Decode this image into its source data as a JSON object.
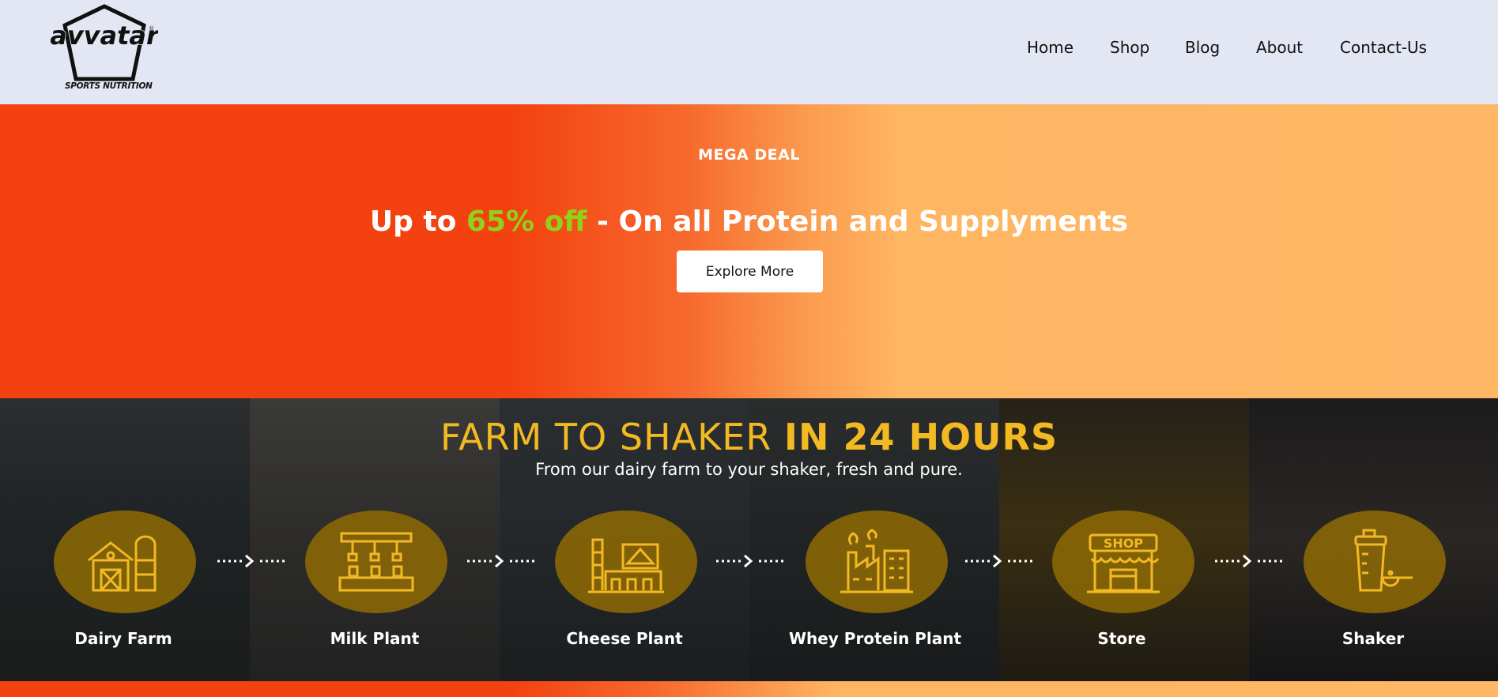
{
  "header": {
    "logo_text": "avvatar",
    "logo_tagline": "SPORTS NUTRITION",
    "nav": [
      {
        "label": "Home"
      },
      {
        "label": "Shop"
      },
      {
        "label": "Blog"
      },
      {
        "label": "About"
      },
      {
        "label": "Contact-Us"
      }
    ]
  },
  "hero": {
    "kicker": "MEGA DEAL",
    "title_prefix": "Up to ",
    "title_highlight": "65% off",
    "title_suffix": " - On all Protein and Supplyments",
    "button_label": "Explore More",
    "highlight_color": "#8ed21b",
    "gradient_start": "#f3410f",
    "gradient_end": "#ffb765"
  },
  "farm_section": {
    "title_light": "FARM TO SHAKER ",
    "title_bold": "IN 24 HOURS",
    "subtitle": "From our dairy farm to your shaker, fresh and pure.",
    "accent_color": "#f3b922",
    "steps": [
      {
        "label": "Dairy Farm",
        "icon": "barn-icon"
      },
      {
        "label": "Milk Plant",
        "icon": "milk-bottling-icon"
      },
      {
        "label": "Cheese Plant",
        "icon": "cheese-factory-icon"
      },
      {
        "label": "Whey Protein Plant",
        "icon": "factory-icon"
      },
      {
        "label": "Store",
        "icon": "shop-icon"
      },
      {
        "label": "Shaker",
        "icon": "shaker-icon"
      }
    ],
    "store_sign": "SHOP"
  }
}
